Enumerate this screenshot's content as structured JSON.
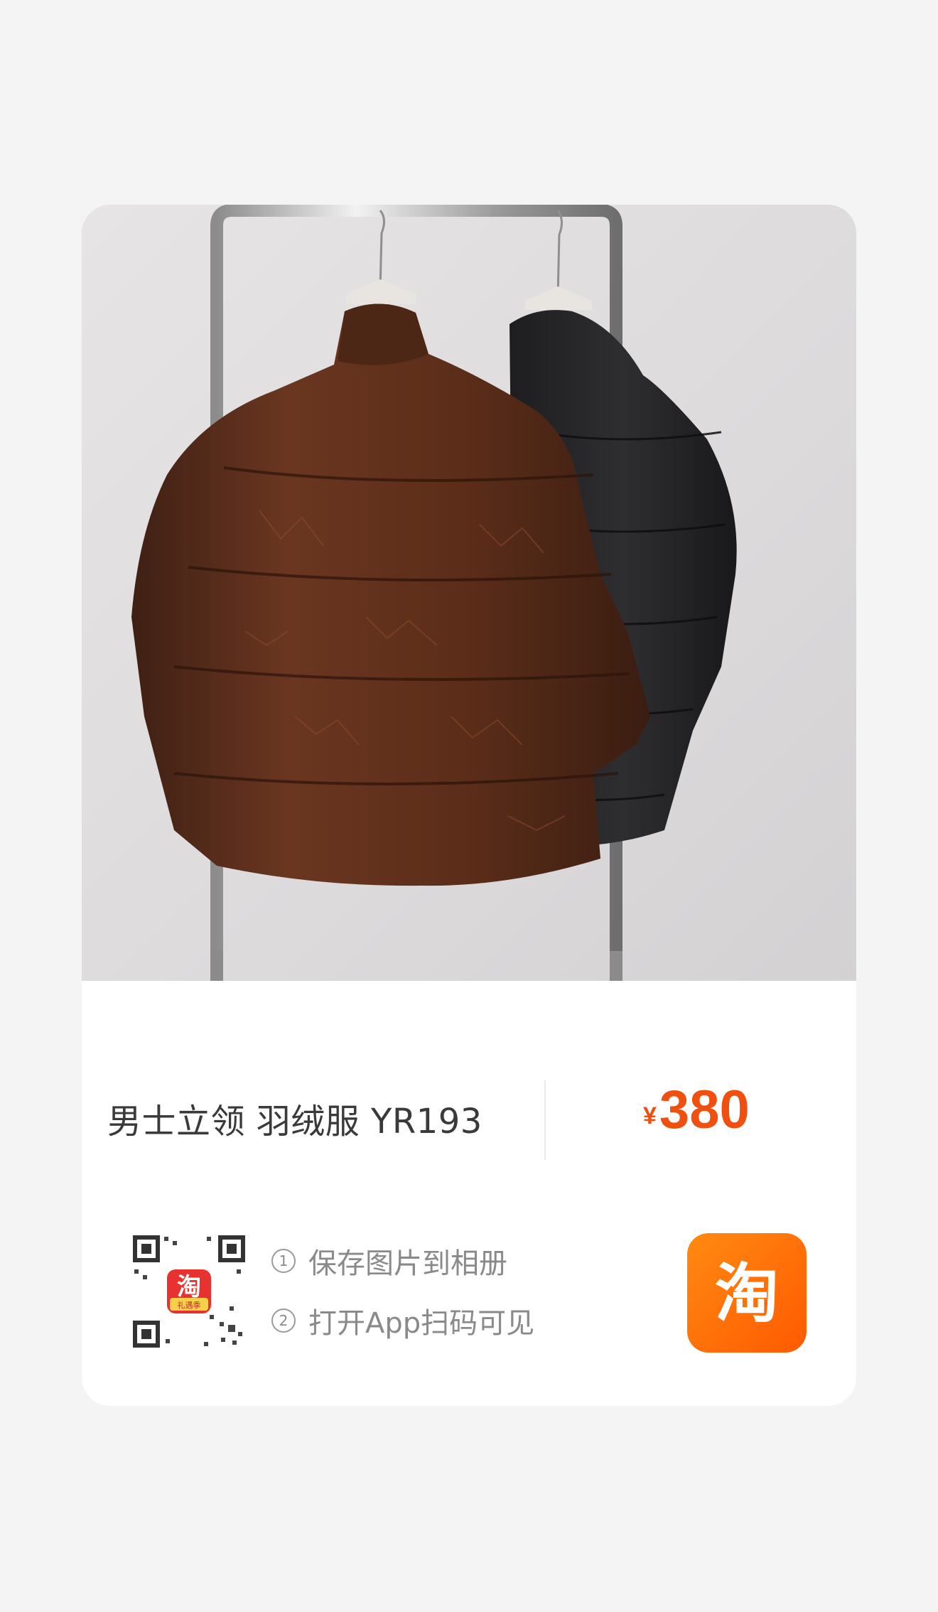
{
  "product": {
    "image_alt": "brown and black puffer jackets hanging on a rack",
    "title": "男士立领 羽绒服 YR193",
    "price_currency": "¥",
    "price_amount": "380"
  },
  "share": {
    "step1_num": "①",
    "step1_text": "保存图片到相册",
    "step2_num": "②",
    "step2_text": "打开App扫码可见",
    "app_logo_char": "淘",
    "qr_badge_char": "淘",
    "qr_badge_sub": "礼遇季"
  },
  "colors": {
    "price": "#f0500f",
    "brand_gradient_start": "#ff8a12",
    "brand_gradient_end": "#ff5a00"
  }
}
